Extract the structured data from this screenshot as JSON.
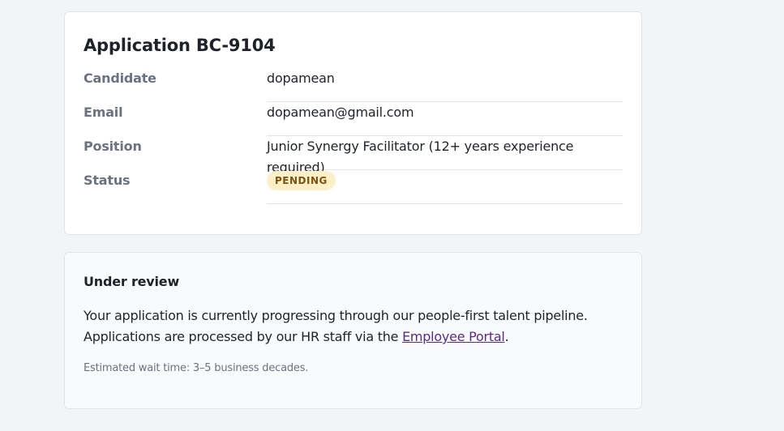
{
  "application": {
    "title": "Application BC-9104",
    "rows": [
      {
        "label": "Candidate",
        "value": "dopamean"
      },
      {
        "label": "Email",
        "value": "dopamean@gmail.com"
      },
      {
        "label": "Position",
        "value": "Junior Synergy Facilitator (12+ years experience required)"
      },
      {
        "label": "Status",
        "value": "PENDING"
      }
    ],
    "status_color": "#fdf0c8"
  },
  "review": {
    "title": "Under review",
    "line1": "Your application is currently progressing through our people-first talent pipeline.",
    "line2_prefix": "Applications are processed by our HR staff via the ",
    "link_text": "Employee Portal",
    "line2_suffix": ".",
    "wait_note": "Estimated wait time: 3–5 business decades.",
    "link_color": "#5b2a86"
  }
}
